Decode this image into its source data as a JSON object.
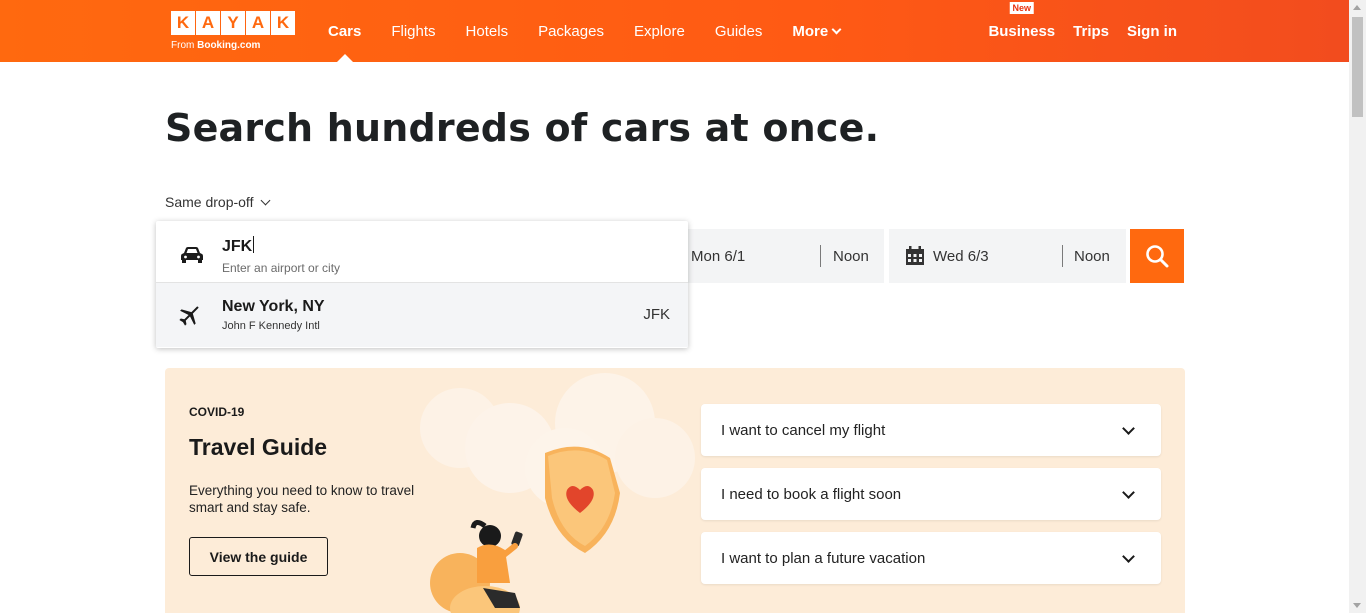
{
  "header": {
    "logo_letters": [
      "K",
      "A",
      "Y",
      "A",
      "K"
    ],
    "logo_sub_prefix": "From ",
    "logo_sub_brand": "Booking.com",
    "nav": [
      {
        "label": "Cars",
        "active": true
      },
      {
        "label": "Flights"
      },
      {
        "label": "Hotels"
      },
      {
        "label": "Packages"
      },
      {
        "label": "Explore"
      },
      {
        "label": "Guides"
      },
      {
        "label": "More"
      }
    ],
    "business_badge": "New",
    "business_label": "Business",
    "trips_label": "Trips",
    "signin_label": "Sign in"
  },
  "hero": {
    "title": "Search hundreds of cars at once.",
    "dropoff_mode": "Same drop-off"
  },
  "search": {
    "location_value": "JFK",
    "location_placeholder": "Enter an airport or city",
    "pickup_date": "Mon 6/1",
    "pickup_time": "Noon",
    "dropoff_date": "Wed 6/3",
    "dropoff_time": "Noon"
  },
  "suggestion": {
    "city": "New York, NY",
    "airport": "John F Kennedy Intl",
    "code": "JFK"
  },
  "guide": {
    "kicker": "COVID-19",
    "title": "Travel Guide",
    "description": "Everything you need to know to travel smart and stay safe.",
    "button_label": "View the guide",
    "faqs": [
      "I want to cancel my flight",
      "I need to book a flight soon",
      "I want to plan a future vacation"
    ]
  },
  "colors": {
    "brand_orange": "#ff690f",
    "guide_background": "#fdecd8"
  }
}
